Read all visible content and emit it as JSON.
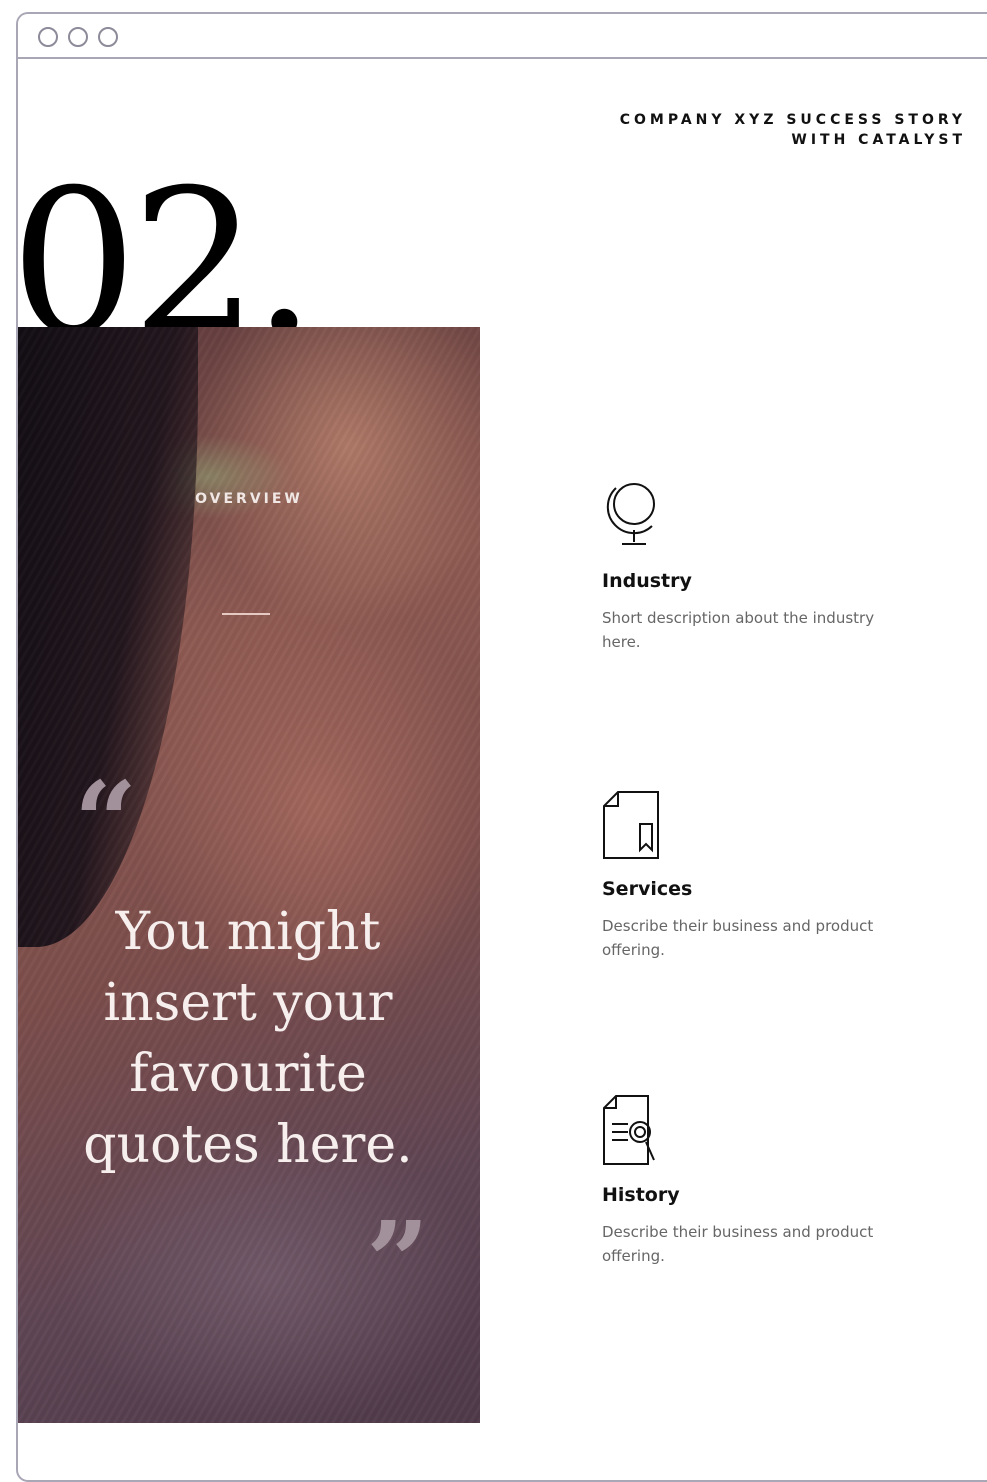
{
  "header": {
    "title_line1": "COMPANY XYZ SUCCESS STORY",
    "title_line2": "WITH CATALYST"
  },
  "section_number": "02.",
  "hero": {
    "label": "OVERVIEW",
    "quote_open": "“",
    "quote": "You might insert your favourite quotes here.",
    "quote_close": "”"
  },
  "features": [
    {
      "icon": "globe-icon",
      "title": "Industry",
      "description": "Short description about the industry here."
    },
    {
      "icon": "document-bookmark-icon",
      "title": "Services",
      "description": "Describe their business and product offering."
    },
    {
      "icon": "document-search-icon",
      "title": "History",
      "description": "Describe their business and product offering."
    }
  ]
}
